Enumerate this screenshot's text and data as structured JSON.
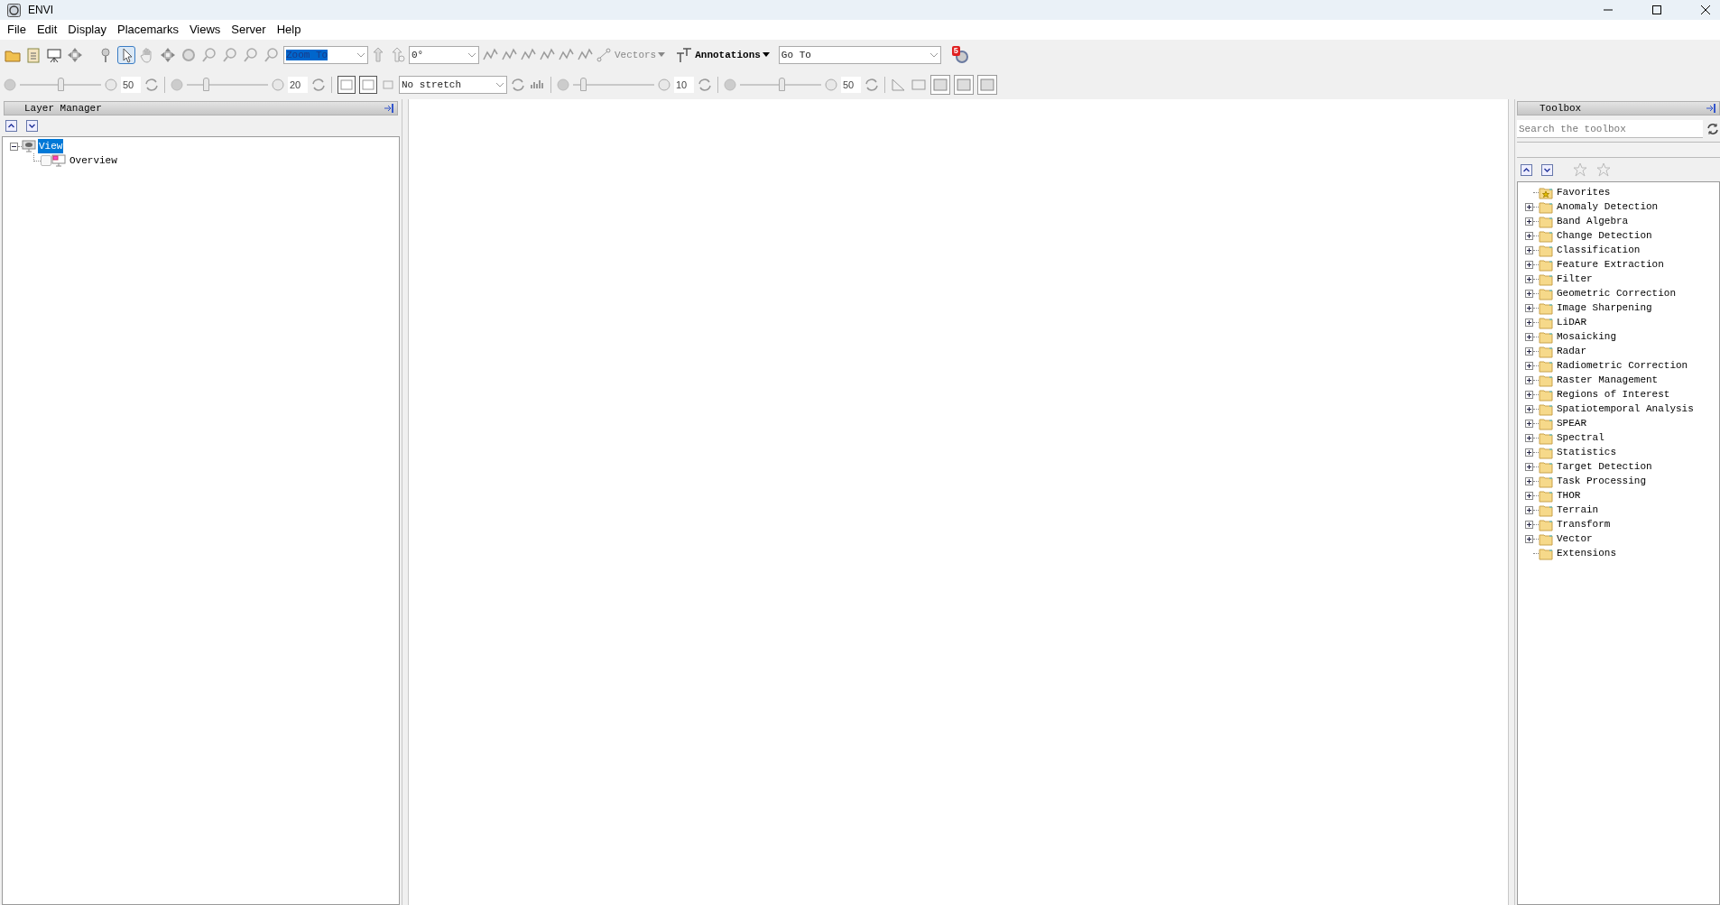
{
  "window": {
    "title": "ENVI"
  },
  "menu": [
    "File",
    "Edit",
    "Display",
    "Placemarks",
    "Views",
    "Server",
    "Help"
  ],
  "toolbar": {
    "tools_a": [
      {
        "kind": "folder",
        "selected": false
      },
      {
        "kind": "clipboard",
        "selected": false
      },
      {
        "kind": "display",
        "selected": false
      },
      {
        "kind": "move",
        "selected": false
      },
      {
        "kind": "pin",
        "selected": false
      },
      {
        "kind": "pointer",
        "selected": true
      },
      {
        "kind": "hand",
        "selected": false
      },
      {
        "kind": "move",
        "selected": false
      },
      {
        "kind": "rotate",
        "selected": false
      },
      {
        "kind": "zoom",
        "selected": false
      },
      {
        "kind": "zoom",
        "selected": false
      },
      {
        "kind": "zoom",
        "selected": false
      },
      {
        "kind": "zoom",
        "selected": false
      }
    ],
    "zoom_combo": {
      "value": "Zoom To"
    },
    "rotation_combo": {
      "value": "0°"
    },
    "vectors": "Vectors",
    "annotations": "Annotations",
    "goto_combo": {
      "value": "Go To"
    },
    "badge": "5"
  },
  "toolbar2": {
    "sliders": [
      {
        "level": 0.5,
        "reading": "50"
      },
      {
        "level": 0.22,
        "reading": "20"
      },
      {
        "level": 0.1,
        "reading": "10"
      },
      {
        "level": 0.52,
        "reading": "50"
      }
    ],
    "stretch": "No stretch"
  },
  "layer_manager": {
    "title": "Layer Manager",
    "tree": [
      {
        "label": "View",
        "selected": true,
        "expanded": true,
        "children": [
          {
            "label": "Overview",
            "checked": false
          }
        ]
      }
    ]
  },
  "toolbox": {
    "title": "Toolbox",
    "search": {
      "placeholder": "Search the toolbox"
    },
    "items": [
      {
        "label": "Favorites",
        "kind": "favorites",
        "expandable": false
      },
      {
        "label": "Anomaly Detection",
        "kind": "folder",
        "expandable": true
      },
      {
        "label": "Band Algebra",
        "kind": "folder",
        "expandable": true
      },
      {
        "label": "Change Detection",
        "kind": "folder",
        "expandable": true
      },
      {
        "label": "Classification",
        "kind": "folder",
        "expandable": true
      },
      {
        "label": "Feature Extraction",
        "kind": "folder",
        "expandable": true
      },
      {
        "label": "Filter",
        "kind": "folder",
        "expandable": true
      },
      {
        "label": "Geometric Correction",
        "kind": "folder",
        "expandable": true
      },
      {
        "label": "Image Sharpening",
        "kind": "folder",
        "expandable": true
      },
      {
        "label": "LiDAR",
        "kind": "folder",
        "expandable": true
      },
      {
        "label": "Mosaicking",
        "kind": "folder",
        "expandable": true
      },
      {
        "label": "Radar",
        "kind": "folder",
        "expandable": true
      },
      {
        "label": "Radiometric Correction",
        "kind": "folder",
        "expandable": true
      },
      {
        "label": "Raster Management",
        "kind": "folder",
        "expandable": true
      },
      {
        "label": "Regions of Interest",
        "kind": "folder",
        "expandable": true
      },
      {
        "label": "Spatiotemporal Analysis",
        "kind": "folder",
        "expandable": true
      },
      {
        "label": "SPEAR",
        "kind": "folder",
        "expandable": true
      },
      {
        "label": "Spectral",
        "kind": "folder",
        "expandable": true
      },
      {
        "label": "Statistics",
        "kind": "folder",
        "expandable": true
      },
      {
        "label": "Target Detection",
        "kind": "folder",
        "expandable": true
      },
      {
        "label": "Task Processing",
        "kind": "folder",
        "expandable": true
      },
      {
        "label": "THOR",
        "kind": "folder",
        "expandable": true
      },
      {
        "label": "Terrain",
        "kind": "folder",
        "expandable": true
      },
      {
        "label": "Transform",
        "kind": "folder",
        "expandable": true
      },
      {
        "label": "Vector",
        "kind": "folder",
        "expandable": true
      },
      {
        "label": "Extensions",
        "kind": "folder",
        "expandable": false
      }
    ]
  }
}
